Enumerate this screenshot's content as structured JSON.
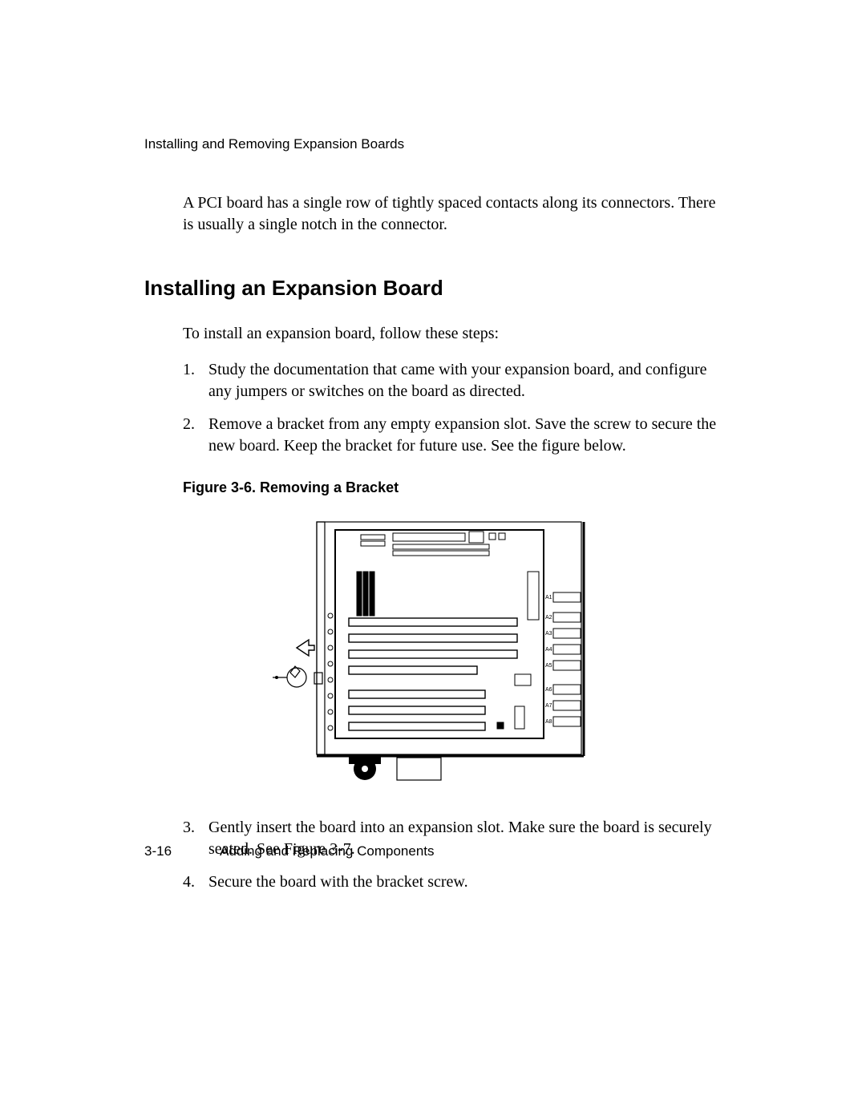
{
  "header": {
    "running_head": "Installing and Removing Expansion Boards"
  },
  "body": {
    "intro": "A PCI board has a single row of tightly spaced contacts along its connectors. There is usually a single notch in the connector.",
    "heading": "Installing an Expansion Board",
    "lede": "To install an expansion board, follow these steps:",
    "steps_a": [
      {
        "n": "1.",
        "t": "Study the documentation that came with your expansion board, and configure any jumpers or switches on the board as directed."
      },
      {
        "n": "2.",
        "t": "Remove a bracket from any empty expansion slot. Save the screw to secure the new board. Keep the bracket for future use. See the figure below."
      }
    ],
    "figcap": "Figure 3-6.  Removing a Bracket",
    "steps_b": [
      {
        "n": "3.",
        "t": "Gently insert the board into an expansion slot. Make sure the board is securely seated. See Figure 3-7."
      },
      {
        "n": "4.",
        "t": "Secure the board with the bracket screw."
      }
    ]
  },
  "figure": {
    "slot_labels": [
      "A1",
      "A2",
      "A3",
      "A4",
      "A5",
      "A6",
      "A7",
      "A8"
    ]
  },
  "footer": {
    "page_num": "3-16",
    "chapter": "Adding and Replacing Components"
  }
}
